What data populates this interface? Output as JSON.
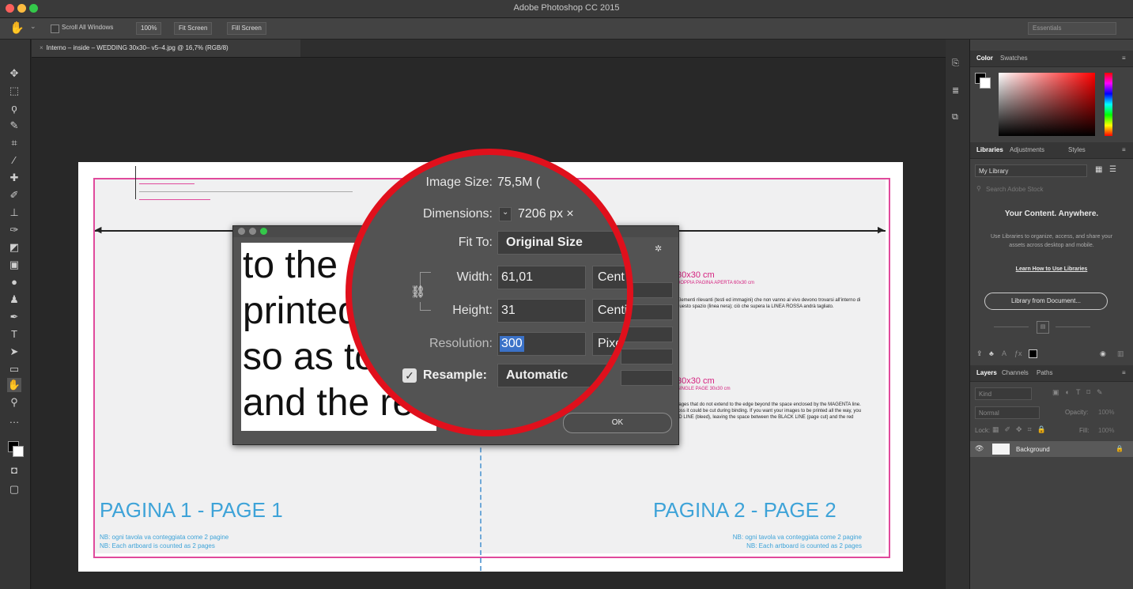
{
  "app": {
    "title": "Adobe Photoshop CC 2015"
  },
  "options_bar": {
    "scroll_all": "Scroll All Windows",
    "zoom": "100%",
    "fit_screen": "Fit Screen",
    "fill_screen": "Fill Screen",
    "workspace": "Essentials"
  },
  "document_tab": {
    "title": "Interno – inside – WEDDING 30x30– v5–4.jpg @ 16,7% (RGB/8)"
  },
  "document": {
    "page1_label": "PAGINA 1 - PAGE 1",
    "page2_label": "PAGINA 2 - PAGE 2",
    "page1_note_it": "NB: ogni tavola va conteggiata come 2 pagine",
    "page1_note_en": "NB: Each artboard is counted as 2 pages",
    "page2_note_it": "NB: ogni tavola va conteggiata come 2 pagine",
    "page2_note_en": "NB: Each artboard is counted as 2 pages",
    "size1": "30x30 cm",
    "size1_sub": "DOPPIA PAGINA APERTA 60x30 cm",
    "size2": "30x30 cm",
    "size2_sub": "SINGLE PAGE 30x30 cm",
    "right_para1": "Elementi rilevanti (testi ed immagini) che non vanno al vivo devono trovarsi all'interno di questo spazio (linea nera); ciò che supera la LINEA ROSSA andrà tagliato.",
    "right_para2": "Do not extend text and images that do not extend to the edge beyond the space enclosed by the MAGENTA line. All parts of objects that cross it could be cut during binding. If you want your images to be printed all the way, you must drag them to the RED LINE (bleed), leaving the space between the BLACK LINE (page cut) and the red line (bleed)."
  },
  "dialog": {
    "preview_lines": [
      "to the e",
      "printed",
      "so as to",
      "and the re"
    ],
    "ok_label": "OK"
  },
  "image_size": {
    "image_size_label": "Image Size:",
    "image_size_value": "75,5M (",
    "dimensions_label": "Dimensions:",
    "dimensions_value": "7206 px  ×",
    "fit_to_label": "Fit To:",
    "fit_to_value": "Original Size",
    "width_label": "Width:",
    "width_value": "61,01",
    "width_unit": "Cent",
    "height_label": "Height:",
    "height_value": "31",
    "height_unit": "Centi",
    "resolution_label": "Resolution:",
    "resolution_value": "300",
    "resolution_unit": "Pixel",
    "resample_label": "Resample:",
    "resample_value": "Automatic"
  },
  "color_panel": {
    "tab_color": "Color",
    "tab_swatches": "Swatches"
  },
  "libraries_panel": {
    "tab_libraries": "Libraries",
    "tab_adjustments": "Adjustments",
    "tab_styles": "Styles",
    "library_select": "My Library",
    "search_placeholder": "Search Adobe Stock",
    "heading": "Your Content. Anywhere.",
    "description": "Use Libraries to organize, access, and share your assets across desktop and mobile.",
    "link": "Learn How to Use Libraries",
    "button": "Library from Document..."
  },
  "layers_panel": {
    "tab_layers": "Layers",
    "tab_channels": "Channels",
    "tab_paths": "Paths",
    "kind_label": "Kind",
    "blend_mode": "Normal",
    "opacity_label": "Opacity:",
    "opacity_value": "100%",
    "lock_label": "Lock:",
    "fill_label": "Fill:",
    "fill_value": "100%",
    "layer_name": "Background"
  },
  "colors": {
    "accent_red": "#e0101c",
    "guide_pink": "#e04a9c",
    "page_blue": "#3ea3d8"
  }
}
